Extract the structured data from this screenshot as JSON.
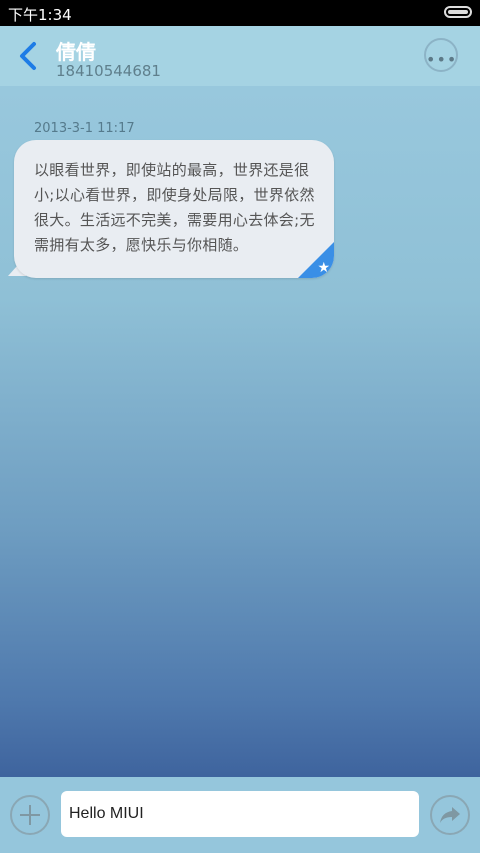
{
  "status_bar": {
    "time": "下午1:34"
  },
  "header": {
    "title": "倩倩",
    "subtitle": "18410544681"
  },
  "conversation": {
    "timestamp": "2013-3-1 11:17",
    "message": "以眼看世界，即使站的最高，世界还是很小;以心看世界，即使身处局限，世界依然很大。生活远不完美，需要用心去体会;无需拥有太多，愿快乐与你相随。"
  },
  "composer": {
    "input_value": "Hello MIUI"
  },
  "icons": {
    "back": "chevron-left-icon",
    "more": "more-dots-icon",
    "star": "star-icon",
    "add": "plus-icon",
    "send": "share-arrow-icon"
  },
  "colors": {
    "accent": "#1e7ce6",
    "star_corner": "#3a8fe6"
  }
}
